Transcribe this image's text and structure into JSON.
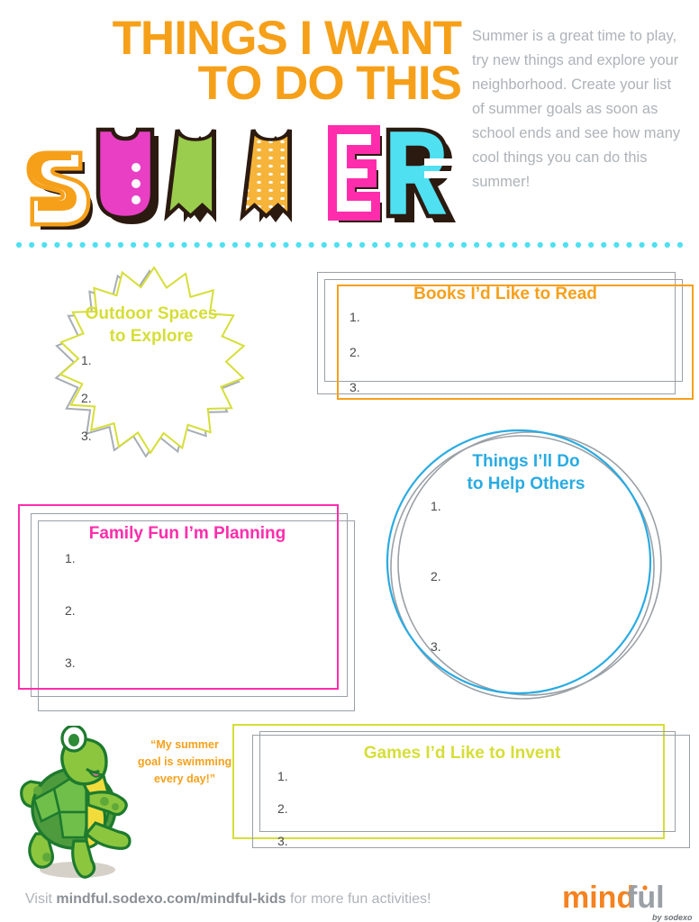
{
  "header": {
    "title_lines": [
      "THINGS I WANT",
      "TO DO THIS"
    ],
    "wordmark": "SUMMER",
    "wordmark_letters": [
      {
        "char": "S",
        "color": "#F6A01A",
        "style": "outline"
      },
      {
        "char": "U",
        "color": "#E83FC4",
        "style": "dots-vertical"
      },
      {
        "char": "M",
        "color": "#9ACC4E",
        "style": "solid-notch"
      },
      {
        "char": "M",
        "color": "#F6B43A",
        "style": "dotted-fill"
      },
      {
        "char": "E",
        "color": "#FF2DAC",
        "style": "outline"
      },
      {
        "char": "R",
        "color": "#4FE0F2",
        "style": "solid-stripe"
      }
    ],
    "intro": "Summer is a great time to play, try new things and explore your neighborhood. Create your list of summer goals as soon as school ends and see how many cool things you can do this summer!"
  },
  "list_numbers": [
    "1.",
    "2.",
    "3."
  ],
  "cards": {
    "outdoor": {
      "title_line1": "Outdoor Spaces",
      "title_line2": "to Explore",
      "color": "#D6DE38",
      "shadow_color": "#A7AEB5",
      "shape": "starburst"
    },
    "books": {
      "title": "Books I’d Like to Read",
      "color": "#F6A01A",
      "shadow_color": "#9aa0a6",
      "shape": "rectangle"
    },
    "family": {
      "title": "Family Fun I’m Planning",
      "color": "#FF2DAC",
      "shadow_color": "#9aa0a6",
      "shape": "rectangle"
    },
    "help": {
      "title_line1": "Things I’ll Do",
      "title_line2": "to Help Others",
      "color": "#29ABE2",
      "shadow_color": "#9aa0a6",
      "shape": "circle"
    },
    "games": {
      "title": "Games I’d Like to Invent",
      "color": "#D6DE38",
      "shadow_color": "#9aa0a6",
      "shape": "rectangle"
    }
  },
  "mascot": {
    "name": "turtle",
    "quote_line1": "“My summer",
    "quote_line2": "goal is swimming",
    "quote_line3": "every day!”",
    "quote_color": "#F6A01A"
  },
  "footer": {
    "prefix": "Visit ",
    "link": "mindful.sodexo.com/mindful-kids",
    "suffix": " for more fun activities!",
    "logo_part1": "mind",
    "logo_part2": "ful",
    "logo_tagline": "by sodexo",
    "logo_color1": "#F58220",
    "logo_color2": "#9aa0a6"
  },
  "divider": {
    "color": "#4FE0F2",
    "dot_count": 53
  }
}
